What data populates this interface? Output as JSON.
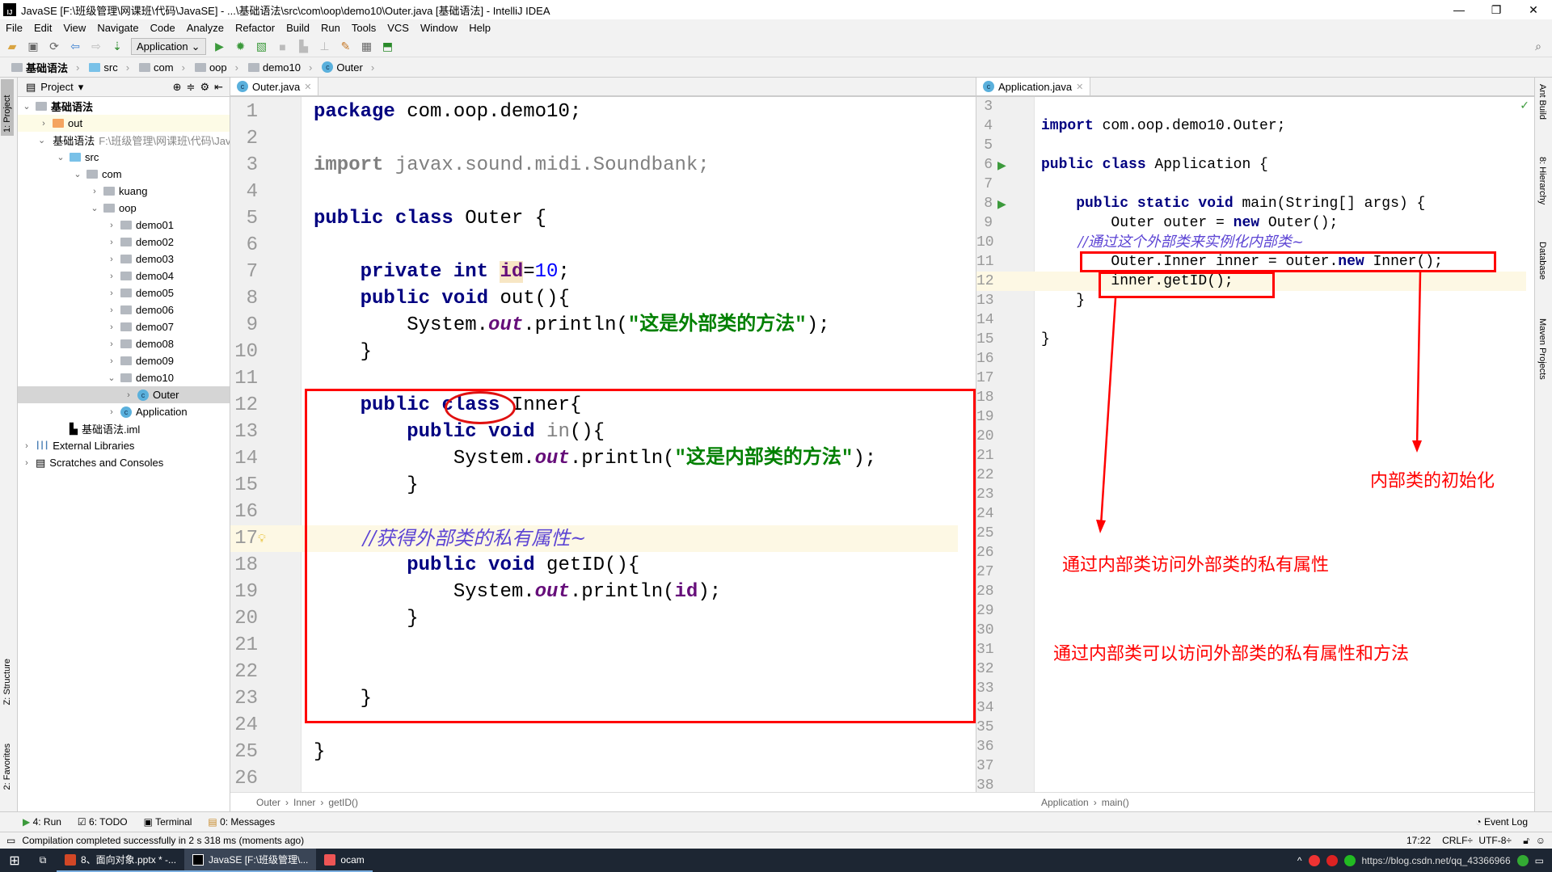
{
  "window": {
    "title": "JavaSE [F:\\班级管理\\网课班\\代码\\JavaSE] - ...\\基础语法\\src\\com\\oop\\demo10\\Outer.java [基础语法] - IntelliJ IDEA",
    "logo": "IJ",
    "minimize": "—",
    "maximize": "❐",
    "close": "✕"
  },
  "menu": [
    "File",
    "Edit",
    "View",
    "Navigate",
    "Code",
    "Analyze",
    "Refactor",
    "Build",
    "Run",
    "Tools",
    "VCS",
    "Window",
    "Help"
  ],
  "toolbar": {
    "run_config": "Application"
  },
  "breadcrumb": [
    "基础语法",
    "src",
    "com",
    "oop",
    "demo10",
    "Outer"
  ],
  "left_strip": {
    "project_tab": "1: Project",
    "structure_tab": "Z: Structure",
    "favorites_tab": "2: Favorites"
  },
  "project": {
    "header": "Project",
    "tree": [
      {
        "label": "基础语法",
        "depth": 0,
        "arrow": "down",
        "icon": "module",
        "bold": true
      },
      {
        "label": "out",
        "depth": 1,
        "arrow": "right",
        "icon": "folder-orange",
        "hl": true
      },
      {
        "label": "基础语法",
        "path": "F:\\班级管理\\网课班\\代码\\JavaSE",
        "depth": 1,
        "arrow": "down",
        "icon": "module"
      },
      {
        "label": "src",
        "depth": 2,
        "arrow": "down",
        "icon": "folder-blue"
      },
      {
        "label": "com",
        "depth": 3,
        "arrow": "down",
        "icon": "folder"
      },
      {
        "label": "kuang",
        "depth": 4,
        "arrow": "right",
        "icon": "folder"
      },
      {
        "label": "oop",
        "depth": 4,
        "arrow": "down",
        "icon": "folder"
      },
      {
        "label": "demo01",
        "depth": 5,
        "arrow": "right",
        "icon": "folder"
      },
      {
        "label": "demo02",
        "depth": 5,
        "arrow": "right",
        "icon": "folder"
      },
      {
        "label": "demo03",
        "depth": 5,
        "arrow": "right",
        "icon": "folder"
      },
      {
        "label": "demo04",
        "depth": 5,
        "arrow": "right",
        "icon": "folder"
      },
      {
        "label": "demo05",
        "depth": 5,
        "arrow": "right",
        "icon": "folder"
      },
      {
        "label": "demo06",
        "depth": 5,
        "arrow": "right",
        "icon": "folder"
      },
      {
        "label": "demo07",
        "depth": 5,
        "arrow": "right",
        "icon": "folder"
      },
      {
        "label": "demo08",
        "depth": 5,
        "arrow": "right",
        "icon": "folder"
      },
      {
        "label": "demo09",
        "depth": 5,
        "arrow": "right",
        "icon": "folder"
      },
      {
        "label": "demo10",
        "depth": 5,
        "arrow": "down",
        "icon": "folder"
      },
      {
        "label": "Outer",
        "depth": 6,
        "arrow": "right",
        "icon": "class",
        "sel": true
      },
      {
        "label": "Application",
        "depth": 5,
        "arrow": "right",
        "icon": "class"
      },
      {
        "label": "基础语法.iml",
        "depth": 2,
        "arrow": "",
        "icon": "file"
      },
      {
        "label": "External Libraries",
        "depth": 0,
        "arrow": "right",
        "icon": "library"
      },
      {
        "label": "Scratches and Consoles",
        "depth": 0,
        "arrow": "right",
        "icon": "scratch"
      }
    ]
  },
  "editor_left": {
    "tab": "Outer.java",
    "first_line": 1,
    "current_line": 17,
    "lines": [
      [
        [
          "package",
          "kw"
        ],
        [
          " com.oop.demo10;",
          ""
        ]
      ],
      [],
      [
        [
          "import",
          "unk"
        ],
        [
          " javax.sound.midi.Soundbank;",
          "unused"
        ]
      ],
      [],
      [
        [
          "public class",
          "kw"
        ],
        [
          " Outer {",
          ""
        ]
      ],
      [],
      [
        [
          "    private int ",
          "kw"
        ],
        [
          "id",
          "fld idhl"
        ],
        [
          "=",
          ""
        ],
        [
          "10",
          "num"
        ],
        [
          ";",
          ""
        ]
      ],
      [
        [
          "    public void ",
          "kw"
        ],
        [
          "out(){",
          ""
        ]
      ],
      [
        [
          "        System.",
          ""
        ],
        [
          "out",
          "st"
        ],
        [
          ".println(",
          ""
        ],
        [
          "\"这是外部类的方法\"",
          "str"
        ],
        [
          ");",
          ""
        ]
      ],
      [
        [
          "    }",
          ""
        ]
      ],
      [],
      [
        [
          "    public ",
          "kw"
        ],
        [
          "class",
          "kw"
        ],
        [
          " Inner{",
          ""
        ]
      ],
      [
        [
          "        public void ",
          "kw"
        ],
        [
          "in",
          "unused"
        ],
        [
          "(){",
          ""
        ]
      ],
      [
        [
          "            System.",
          ""
        ],
        [
          "out",
          "st"
        ],
        [
          ".println(",
          ""
        ],
        [
          "\"这是内部类的方法\"",
          "str"
        ],
        [
          ");",
          ""
        ]
      ],
      [
        [
          "        }",
          ""
        ]
      ],
      [],
      [
        [
          "        //获得外部类的私有属性~",
          "cm"
        ]
      ],
      [
        [
          "        public void ",
          "kw"
        ],
        [
          "getID(){",
          ""
        ]
      ],
      [
        [
          "            System.",
          ""
        ],
        [
          "out",
          "st"
        ],
        [
          ".println(",
          ""
        ],
        [
          "id",
          "fld"
        ],
        [
          ");",
          ""
        ]
      ],
      [
        [
          "        }",
          ""
        ]
      ],
      [],
      [],
      [
        [
          "    }",
          ""
        ]
      ],
      [],
      [
        [
          "}",
          ""
        ]
      ],
      []
    ],
    "breadcrumb": [
      "Outer",
      "Inner",
      "getID()"
    ]
  },
  "editor_right": {
    "tab": "Application.java",
    "first_line": 3,
    "current_line": 12,
    "lines": [
      [],
      [
        [
          "import",
          "kw"
        ],
        [
          " com.oop.demo10.Outer;",
          ""
        ]
      ],
      [],
      [
        [
          "public class",
          "kw"
        ],
        [
          " Application {",
          ""
        ]
      ],
      [],
      [
        [
          "    public static void ",
          "kw"
        ],
        [
          "main(String[] args) {",
          ""
        ]
      ],
      [
        [
          "        Outer outer = ",
          ""
        ],
        [
          "new",
          "kw"
        ],
        [
          " Outer();",
          ""
        ]
      ],
      [
        [
          "        //通过这个外部类来实例化内部类~",
          "cm"
        ]
      ],
      [
        [
          "        Outer.Inner inner = outer.",
          ""
        ],
        [
          "new",
          "kw"
        ],
        [
          " Inner();",
          ""
        ]
      ],
      [
        [
          "        inner.getID();",
          ""
        ]
      ],
      [
        [
          "    }",
          ""
        ]
      ],
      [],
      [
        [
          "}",
          ""
        ]
      ],
      [],
      [],
      [],
      [],
      [],
      [],
      [],
      [],
      [],
      [],
      [],
      [],
      [],
      [],
      [],
      [],
      [],
      [],
      [],
      [],
      [],
      [],
      []
    ],
    "breadcrumb": [
      "Application",
      "main()"
    ]
  },
  "annotations": {
    "init_note": "内部类的初始化",
    "access_note": "通过内部类访问外部类的私有属性",
    "access_methods_note": "通过内部类可以访问外部类的私有属性和方法",
    "color": "#ff0000"
  },
  "right_strip": [
    "Ant Build",
    "8: Hierarchy",
    "Database",
    "Maven Projects"
  ],
  "tool_tabs": {
    "run": "4: Run",
    "todo": "6: TODO",
    "terminal": "Terminal",
    "messages": "0: Messages",
    "event_log": "Event Log"
  },
  "status": {
    "message": "Compilation completed successfully in 2 s 318 ms (moments ago)",
    "position": "17:22",
    "line_sep": "CRLF÷",
    "encoding": "UTF-8÷"
  },
  "taskbar": {
    "items": [
      "8、面向对象.pptx * -...",
      "JavaSE [F:\\班级管理\\...",
      "ocam"
    ],
    "tray_text": "https://blog.csdn.net/qq_43366966"
  }
}
